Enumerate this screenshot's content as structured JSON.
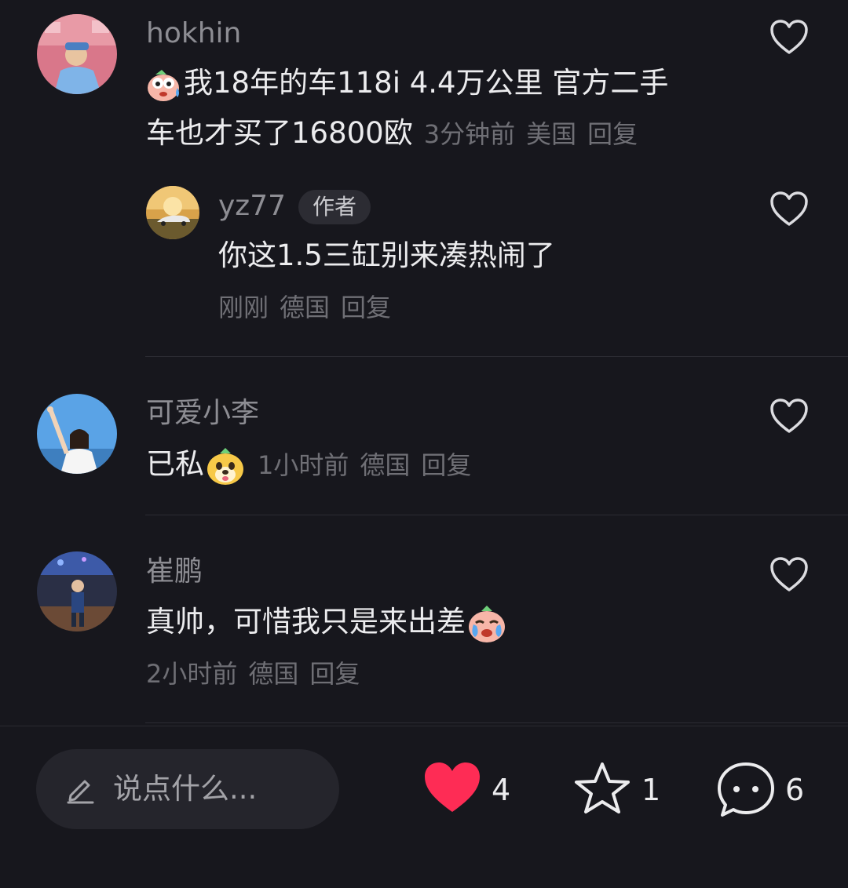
{
  "comments": [
    {
      "username": "hokhin",
      "text_line1": "我18年的车118i 4.4万公里 官方二手",
      "text_line2": "车也才买了16800欧",
      "time": "3分钟前",
      "location": "美国",
      "reply_label": "回复",
      "reply": {
        "username": "yz77",
        "badge": "作者",
        "text": "你这1.5三缸别来凑热闹了",
        "time": "刚刚",
        "location": "德国",
        "reply_label": "回复"
      }
    },
    {
      "username": "可爱小李",
      "text": "已私",
      "time": "1小时前",
      "location": "德国",
      "reply_label": "回复"
    },
    {
      "username": "崔鹏",
      "text": "真帅，可惜我只是来出差",
      "time": "2小时前",
      "location": "德国",
      "reply_label": "回复"
    }
  ],
  "bottom_bar": {
    "input_placeholder": "说点什么...",
    "like_count": "4",
    "favorite_count": "1",
    "comment_count": "6"
  },
  "icons": {
    "like": "heart-filled-icon",
    "favorite": "star-icon",
    "comment": "speech-bubble-icon",
    "comment_like": "heart-outline-icon",
    "edit": "pencil-icon"
  },
  "colors": {
    "background": "#17171d",
    "like_red": "#fe2c55",
    "text_primary": "#ececee",
    "text_secondary": "#8d8d93"
  }
}
